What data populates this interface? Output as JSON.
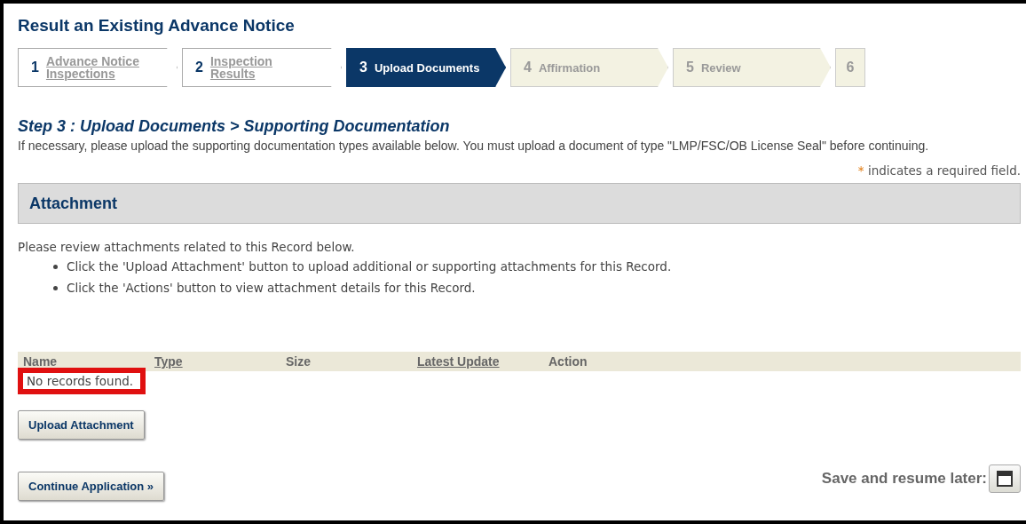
{
  "title": "Result an Existing Advance Notice",
  "steps": [
    {
      "number": "1",
      "label": "Advance Notice Inspections",
      "kind": "done"
    },
    {
      "number": "2",
      "label": "Inspection Results",
      "kind": "done"
    },
    {
      "number": "3",
      "label": "Upload Documents",
      "kind": "current"
    },
    {
      "number": "4",
      "label": "Affirmation",
      "kind": "future"
    },
    {
      "number": "5",
      "label": "Review",
      "kind": "future"
    },
    {
      "number": "6",
      "kind": "future"
    }
  ],
  "step_heading": "Step 3 : Upload Documents > Supporting Documentation",
  "instructions": "If necessary, please upload the supporting documentation types available below. You must upload a document of type \"LMP/FSC/OB License Seal\" before continuing.",
  "required_note": {
    "mark": "*",
    "text": "indicates a required field."
  },
  "section_title": "Attachment",
  "intro": "Please review attachments related to this Record below.",
  "bullets": [
    "Click the 'Upload Attachment' button to upload additional or supporting attachments for this Record.",
    "Click the 'Actions' button to view attachment details for this Record."
  ],
  "table": {
    "columns": [
      {
        "label": "Name",
        "link": false
      },
      {
        "label": "Type",
        "link": true
      },
      {
        "label": "Size",
        "link": false
      },
      {
        "label": "Latest Update",
        "link": true
      },
      {
        "label": "Action",
        "link": false
      }
    ],
    "empty_text": "No records found."
  },
  "buttons": [
    "Upload Attachment",
    "Continue Application »"
  ],
  "save_label": "Save and resume later:"
}
